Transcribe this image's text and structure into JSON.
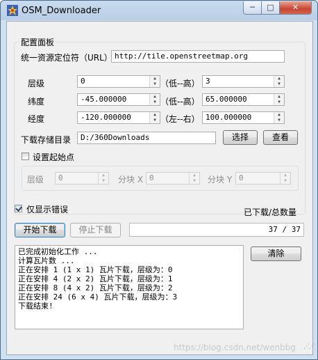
{
  "window": {
    "title": "OSM_Downloader",
    "controls": {
      "minimize": "─",
      "maximize": "□",
      "close": "✕"
    }
  },
  "config": {
    "group_title": "配置面板",
    "url_label": "统一资源定位符（URL）",
    "url_value": "http://tile.openstreetmap.org",
    "level": {
      "label": "层级",
      "min": "0",
      "range_label": "（低--高）",
      "max": "3"
    },
    "latitude": {
      "label": "纬度",
      "min": "-45.000000",
      "range_label": "（低--高）",
      "max": "65.000000"
    },
    "longitude": {
      "label": "经度",
      "min": "-120.000000",
      "range_label": "（左--右）",
      "max": "100.000000"
    },
    "dir_label": "下载存储目录",
    "dir_value": "D:/360Downloads",
    "select_button": "选择",
    "view_button": "查看",
    "start_point": {
      "checkbox_label": "设置起始点",
      "level_label": "层级",
      "level_value": "0",
      "tile_x_label": "分块 X",
      "tile_x_value": "0",
      "tile_y_label": "分块 Y",
      "tile_y_value": "0"
    }
  },
  "errors_only_label": "仅显示错误",
  "progress_label": "已下载/总数量",
  "start_button": "开始下载",
  "stop_button": "停止下载",
  "progress": {
    "text": "37 / 37",
    "done": 37,
    "total": 37
  },
  "clear_button": "清除",
  "log_lines": [
    "已完成初始化工作 ...",
    "计算瓦片数 ...",
    "正在安排 1 (1 x 1) 瓦片下载，层级为：0",
    "正在安排 4 (2 x 2) 瓦片下载，层级为：1",
    "正在安排 8 (4 x 2) 瓦片下载，层级为：2",
    "正在安排 24 (6 x 4) 瓦片下载，层级为：3",
    "下载结束!"
  ],
  "watermark": "https://blog.csdn.net/wenbbg"
}
